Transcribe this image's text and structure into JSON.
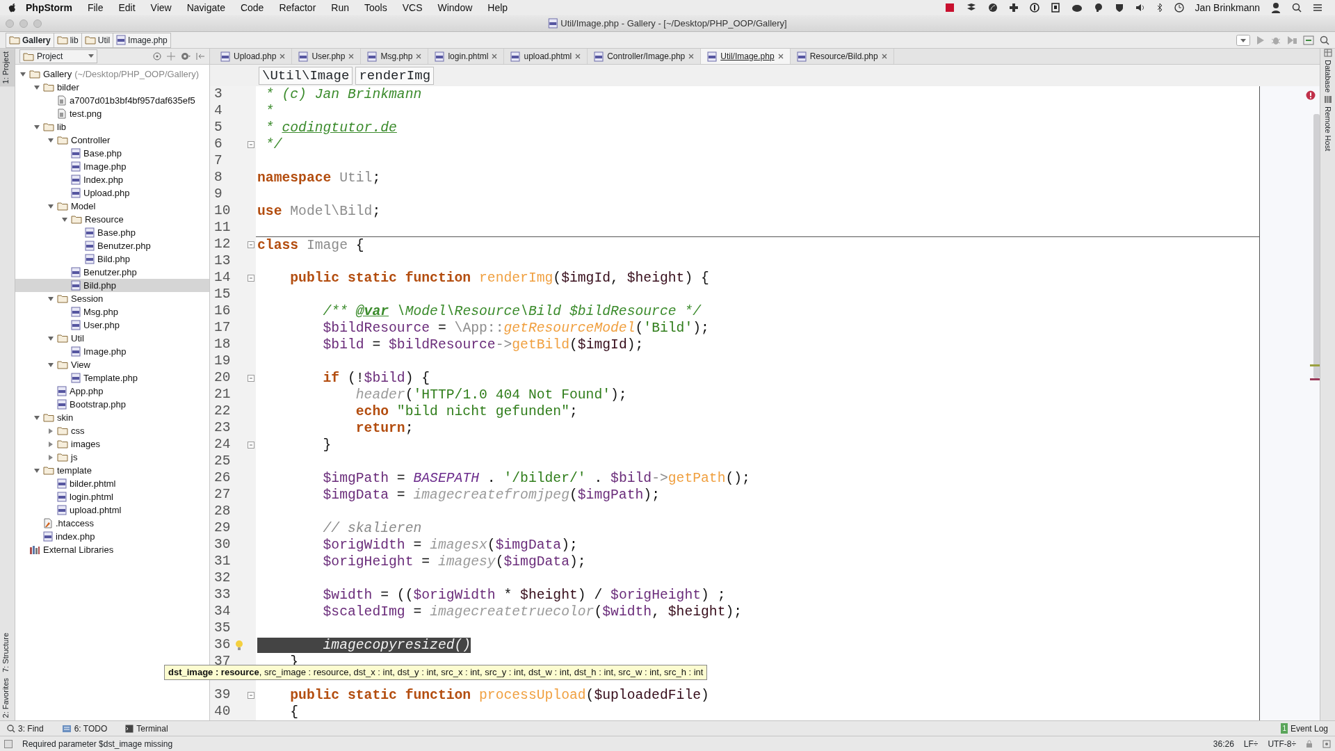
{
  "menu_bar": {
    "app": "PhpStorm",
    "items": [
      "File",
      "Edit",
      "View",
      "Navigate",
      "Code",
      "Refactor",
      "Run",
      "Tools",
      "VCS",
      "Window",
      "Help"
    ],
    "user": "Jan Brinkmann"
  },
  "window": {
    "title": "Util/Image.php - Gallery - [~/Desktop/PHP_OOP/Gallery]"
  },
  "breadcrumbs": [
    "Gallery",
    "lib",
    "Util",
    "Image.php"
  ],
  "project_panel": {
    "title": "Project"
  },
  "tabs": [
    {
      "label": "Upload.php",
      "selected": false
    },
    {
      "label": "User.php",
      "selected": false
    },
    {
      "label": "Msg.php",
      "selected": false
    },
    {
      "label": "login.phtml",
      "selected": false
    },
    {
      "label": "upload.phtml",
      "selected": false
    },
    {
      "label": "Controller/Image.php",
      "selected": false
    },
    {
      "label": "Util/Image.php",
      "selected": true
    },
    {
      "label": "Resource/Bild.php",
      "selected": false
    }
  ],
  "tree": [
    {
      "label": "Gallery",
      "path": "(~/Desktop/PHP_OOP/Gallery)",
      "kind": "folder",
      "expanded": true,
      "selected": false,
      "children": [
        {
          "label": "bilder",
          "kind": "folder",
          "expanded": true,
          "selected": false,
          "children": [
            {
              "label": "a7007d01b3bf4bf957daf635ef5",
              "kind": "file",
              "selected": false
            },
            {
              "label": "test.png",
              "kind": "file",
              "selected": false
            }
          ]
        },
        {
          "label": "lib",
          "kind": "folder",
          "expanded": true,
          "selected": false,
          "children": [
            {
              "label": "Controller",
              "kind": "folder",
              "expanded": true,
              "selected": false,
              "children": [
                {
                  "label": "Base.php",
                  "kind": "php",
                  "selected": false
                },
                {
                  "label": "Image.php",
                  "kind": "php",
                  "selected": false
                },
                {
                  "label": "Index.php",
                  "kind": "php",
                  "selected": false
                },
                {
                  "label": "Upload.php",
                  "kind": "php",
                  "selected": false
                }
              ]
            },
            {
              "label": "Model",
              "kind": "folder",
              "expanded": true,
              "selected": false,
              "children": [
                {
                  "label": "Resource",
                  "kind": "folder",
                  "expanded": true,
                  "selected": false,
                  "children": [
                    {
                      "label": "Base.php",
                      "kind": "php",
                      "selected": false
                    },
                    {
                      "label": "Benutzer.php",
                      "kind": "php",
                      "selected": false
                    },
                    {
                      "label": "Bild.php",
                      "kind": "php",
                      "selected": false
                    }
                  ]
                },
                {
                  "label": "Benutzer.php",
                  "kind": "php",
                  "selected": false
                },
                {
                  "label": "Bild.php",
                  "kind": "php",
                  "selected": true
                }
              ]
            },
            {
              "label": "Session",
              "kind": "folder",
              "expanded": true,
              "selected": false,
              "children": [
                {
                  "label": "Msg.php",
                  "kind": "php",
                  "selected": false
                },
                {
                  "label": "User.php",
                  "kind": "php",
                  "selected": false
                }
              ]
            },
            {
              "label": "Util",
              "kind": "folder",
              "expanded": true,
              "selected": false,
              "children": [
                {
                  "label": "Image.php",
                  "kind": "php",
                  "selected": false
                }
              ]
            },
            {
              "label": "View",
              "kind": "folder",
              "expanded": true,
              "selected": false,
              "children": [
                {
                  "label": "Template.php",
                  "kind": "php",
                  "selected": false
                }
              ]
            },
            {
              "label": "App.php",
              "kind": "php",
              "selected": false
            },
            {
              "label": "Bootstrap.php",
              "kind": "php",
              "selected": false
            }
          ]
        },
        {
          "label": "skin",
          "kind": "folder",
          "expanded": true,
          "selected": false,
          "children": [
            {
              "label": "css",
              "kind": "folder",
              "expanded": false,
              "selected": false
            },
            {
              "label": "images",
              "kind": "folder",
              "expanded": false,
              "selected": false
            },
            {
              "label": "js",
              "kind": "folder",
              "expanded": false,
              "selected": false
            }
          ]
        },
        {
          "label": "template",
          "kind": "folder",
          "expanded": true,
          "selected": false,
          "children": [
            {
              "label": "bilder.phtml",
              "kind": "php",
              "selected": false
            },
            {
              "label": "login.phtml",
              "kind": "php",
              "selected": false
            },
            {
              "label": "upload.phtml",
              "kind": "php",
              "selected": false
            }
          ]
        },
        {
          "label": ".htaccess",
          "kind": "config",
          "selected": false
        },
        {
          "label": "index.php",
          "kind": "php",
          "selected": false
        }
      ]
    },
    {
      "label": "External Libraries",
      "kind": "library",
      "selected": false
    }
  ],
  "editor_breadcrumbs": [
    "\\Util\\Image",
    "renderImg"
  ],
  "code": [
    {
      "no": "3",
      "tokens": [
        {
          "kind": "doc",
          "text": " * (c) Jan Brinkmann"
        }
      ]
    },
    {
      "no": "4",
      "tokens": [
        {
          "kind": "doc",
          "text": " *"
        }
      ]
    },
    {
      "no": "5",
      "tokens": [
        {
          "kind": "doc",
          "text": " * "
        },
        {
          "kind": "link",
          "text": "codingtutor.de"
        }
      ]
    },
    {
      "no": "6",
      "fold": true,
      "tokens": [
        {
          "kind": "doc",
          "text": " */"
        }
      ]
    },
    {
      "no": "7"
    },
    {
      "no": "8",
      "tokens": [
        {
          "kind": "kw",
          "text": "namespace "
        },
        {
          "kind": "cls",
          "text": "Util"
        },
        {
          "kind": "p",
          "text": ";"
        }
      ]
    },
    {
      "no": "9"
    },
    {
      "no": "10",
      "tokens": [
        {
          "kind": "kw",
          "text": "use "
        },
        {
          "kind": "cls",
          "text": "Model\\Bild"
        },
        {
          "kind": "p",
          "text": ";"
        }
      ]
    },
    {
      "no": "11"
    },
    {
      "no": "12",
      "fold": true,
      "separator": true,
      "tokens": [
        {
          "kind": "kw",
          "text": "class "
        },
        {
          "kind": "cls",
          "text": "Image"
        },
        {
          "kind": "p",
          "text": " {"
        }
      ]
    },
    {
      "no": "13"
    },
    {
      "no": "14",
      "fold": true,
      "tokens": [
        {
          "kind": "kw",
          "text": "    public static function "
        },
        {
          "kind": "fn",
          "text": "renderImg"
        },
        {
          "kind": "p",
          "text": "("
        },
        {
          "kind": "param",
          "text": "$imgId"
        },
        {
          "kind": "p",
          "text": ", "
        },
        {
          "kind": "param",
          "text": "$height"
        },
        {
          "kind": "p",
          "text": ") {"
        }
      ]
    },
    {
      "no": "15"
    },
    {
      "no": "16",
      "tokens": [
        {
          "kind": "doc",
          "text": "        /** "
        },
        {
          "kind": "tag",
          "text": "@var"
        },
        {
          "kind": "doc",
          "text": " \\Model\\Resource\\Bild $bildResource */"
        }
      ]
    },
    {
      "no": "17",
      "tokens": [
        {
          "kind": "var",
          "text": "        $bildResource"
        },
        {
          "kind": "p",
          "text": " = "
        },
        {
          "kind": "cls",
          "text": "\\App::"
        },
        {
          "kind": "fni",
          "text": "getResourceModel"
        },
        {
          "kind": "p",
          "text": "("
        },
        {
          "kind": "str",
          "text": "'Bild'"
        },
        {
          "kind": "p",
          "text": ");"
        }
      ]
    },
    {
      "no": "18",
      "tokens": [
        {
          "kind": "var",
          "text": "        $bild"
        },
        {
          "kind": "p",
          "text": " = "
        },
        {
          "kind": "var",
          "text": "$bildResource"
        },
        {
          "kind": "cls",
          "text": "->"
        },
        {
          "kind": "fn",
          "text": "getBild"
        },
        {
          "kind": "p",
          "text": "("
        },
        {
          "kind": "param",
          "text": "$imgId"
        },
        {
          "kind": "p",
          "text": ");"
        }
      ]
    },
    {
      "no": "19"
    },
    {
      "no": "20",
      "fold": true,
      "tokens": [
        {
          "kind": "kw",
          "text": "        if"
        },
        {
          "kind": "p",
          "text": " (!"
        },
        {
          "kind": "var",
          "text": "$bild"
        },
        {
          "kind": "p",
          "text": ") {"
        }
      ]
    },
    {
      "no": "21",
      "tokens": [
        {
          "kind": "bi",
          "text": "            header"
        },
        {
          "kind": "p",
          "text": "("
        },
        {
          "kind": "str",
          "text": "'HTTP/1.0 404 Not Found'"
        },
        {
          "kind": "p",
          "text": ");"
        }
      ]
    },
    {
      "no": "22",
      "tokens": [
        {
          "kind": "kw",
          "text": "            echo "
        },
        {
          "kind": "str",
          "text": "\"bild nicht gefunden\""
        },
        {
          "kind": "p",
          "text": ";"
        }
      ]
    },
    {
      "no": "23",
      "tokens": [
        {
          "kind": "kw",
          "text": "            return"
        },
        {
          "kind": "p",
          "text": ";"
        }
      ]
    },
    {
      "no": "24",
      "fold": true,
      "tokens": [
        {
          "kind": "p",
          "text": "        }"
        }
      ]
    },
    {
      "no": "25"
    },
    {
      "no": "26",
      "tokens": [
        {
          "kind": "var",
          "text": "        $imgPath"
        },
        {
          "kind": "p",
          "text": " = "
        },
        {
          "kind": "const",
          "text": "BASEPATH"
        },
        {
          "kind": "p",
          "text": " . "
        },
        {
          "kind": "str",
          "text": "'/bilder/'"
        },
        {
          "kind": "p",
          "text": " . "
        },
        {
          "kind": "var",
          "text": "$bild"
        },
        {
          "kind": "cls",
          "text": "->"
        },
        {
          "kind": "fn",
          "text": "getPath"
        },
        {
          "kind": "p",
          "text": "();"
        }
      ]
    },
    {
      "no": "27",
      "tokens": [
        {
          "kind": "var",
          "text": "        $imgData"
        },
        {
          "kind": "p",
          "text": " = "
        },
        {
          "kind": "bi",
          "text": "imagecreatefromjpeg"
        },
        {
          "kind": "p",
          "text": "("
        },
        {
          "kind": "var",
          "text": "$imgPath"
        },
        {
          "kind": "p",
          "text": ");"
        }
      ]
    },
    {
      "no": "28"
    },
    {
      "no": "29",
      "tokens": [
        {
          "kind": "cmt",
          "text": "        // skalieren"
        }
      ]
    },
    {
      "no": "30",
      "tokens": [
        {
          "kind": "var",
          "text": "        $origWidth"
        },
        {
          "kind": "p",
          "text": " = "
        },
        {
          "kind": "bi",
          "text": "imagesx"
        },
        {
          "kind": "p",
          "text": "("
        },
        {
          "kind": "var",
          "text": "$imgData"
        },
        {
          "kind": "p",
          "text": ");"
        }
      ]
    },
    {
      "no": "31",
      "tokens": [
        {
          "kind": "var",
          "text": "        $origHeight"
        },
        {
          "kind": "p",
          "text": " = "
        },
        {
          "kind": "bi",
          "text": "imagesy"
        },
        {
          "kind": "p",
          "text": "("
        },
        {
          "kind": "var",
          "text": "$imgData"
        },
        {
          "kind": "p",
          "text": ");"
        }
      ]
    },
    {
      "no": "32"
    },
    {
      "no": "33",
      "tokens": [
        {
          "kind": "var",
          "text": "        $width"
        },
        {
          "kind": "p",
          "text": " = (("
        },
        {
          "kind": "var",
          "text": "$origWidth"
        },
        {
          "kind": "p",
          "text": " * "
        },
        {
          "kind": "param",
          "text": "$height"
        },
        {
          "kind": "p",
          "text": ") / "
        },
        {
          "kind": "var",
          "text": "$origHeight"
        },
        {
          "kind": "p",
          "text": ") ;"
        }
      ]
    },
    {
      "no": "34",
      "tokens": [
        {
          "kind": "var",
          "text": "        $scaledImg"
        },
        {
          "kind": "p",
          "text": " = "
        },
        {
          "kind": "bi",
          "text": "imagecreatetruecolor"
        },
        {
          "kind": "p",
          "text": "("
        },
        {
          "kind": "var",
          "text": "$width"
        },
        {
          "kind": "p",
          "text": ", "
        },
        {
          "kind": "param",
          "text": "$height"
        },
        {
          "kind": "p",
          "text": ");"
        }
      ]
    },
    {
      "no": "35"
    },
    {
      "no": "36",
      "bulb": true,
      "tokens": [
        {
          "kind": "sel",
          "text": "        imagecopyresized()"
        }
      ]
    },
    {
      "no": "37",
      "tokens": [
        {
          "kind": "p",
          "text": "    }"
        }
      ]
    },
    {
      "kind": "tooltip",
      "text": "**dst_image : resource**, src_image : resource, dst_x : int, dst_y : int, src_x : int, src_y : int, dst_w : int, dst_h : int, src_w : int, src_h : int"
    },
    {
      "no": "39",
      "fold": true,
      "tokens": [
        {
          "kind": "kw",
          "text": "    public static function "
        },
        {
          "kind": "fn",
          "text": "processUpload"
        },
        {
          "kind": "p",
          "text": "("
        },
        {
          "kind": "param",
          "text": "$uploadedFile"
        },
        {
          "kind": "p",
          "text": ")"
        }
      ]
    },
    {
      "no": "40",
      "tokens": [
        {
          "kind": "p",
          "text": "    {"
        }
      ]
    }
  ],
  "left_strip": [
    {
      "label": "1: Project",
      "selected": true
    },
    {
      "label": "7: Structure",
      "selected": false
    },
    {
      "label": "2: Favorites",
      "selected": false
    }
  ],
  "right_strip": [
    "Database",
    "Remote Host"
  ],
  "tool_buttons": [
    "3: Find",
    "6: TODO",
    "Terminal"
  ],
  "event_log": {
    "count": "1",
    "label": "Event Log"
  },
  "status_bar": {
    "message": "Required parameter $dst_image missing",
    "position": "36:26",
    "line_separator": "LF÷",
    "encoding": "UTF-8÷"
  }
}
